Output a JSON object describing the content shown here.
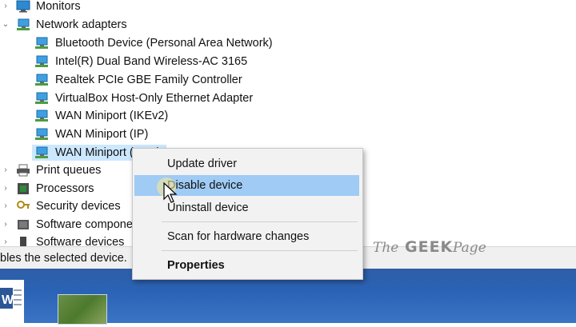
{
  "tree": {
    "items": [
      {
        "label": "Monitors",
        "expander": "›",
        "level": 0,
        "icon": "monitor-icon"
      },
      {
        "label": "Network adapters",
        "expander": "⌄",
        "level": 0,
        "icon": "network-adapter-icon"
      },
      {
        "label": "Bluetooth Device (Personal Area Network)",
        "level": 1,
        "icon": "network-adapter-icon"
      },
      {
        "label": "Intel(R) Dual Band Wireless-AC 3165",
        "level": 1,
        "icon": "network-adapter-icon"
      },
      {
        "label": "Realtek PCIe GBE Family Controller",
        "level": 1,
        "icon": "network-adapter-icon"
      },
      {
        "label": "VirtualBox Host-Only Ethernet Adapter",
        "level": 1,
        "icon": "network-adapter-icon"
      },
      {
        "label": "WAN Miniport (IKEv2)",
        "level": 1,
        "icon": "network-adapter-icon"
      },
      {
        "label": "WAN Miniport (IP)",
        "level": 1,
        "icon": "network-adapter-icon"
      },
      {
        "label": "WAN Miniport (IPv6)",
        "level": 1,
        "icon": "network-adapter-icon",
        "selected": true
      },
      {
        "label": "Print queues",
        "expander": "›",
        "level": 0,
        "icon": "printer-icon"
      },
      {
        "label": "Processors",
        "expander": "›",
        "level": 0,
        "icon": "processor-icon"
      },
      {
        "label": "Security devices",
        "expander": "›",
        "level": 0,
        "icon": "security-device-icon"
      },
      {
        "label": "Software components",
        "expander": "›",
        "level": 0,
        "icon": "software-component-icon"
      },
      {
        "label": "Software devices",
        "expander": "›",
        "level": 0,
        "icon": "software-device-icon"
      }
    ]
  },
  "context_menu": {
    "update_driver": "Update driver",
    "disable_device": "Disable device",
    "uninstall_device": "Uninstall device",
    "scan_hardware": "Scan for hardware changes",
    "properties": "Properties"
  },
  "status_bar": {
    "text": "bles the selected device."
  },
  "watermark": {
    "the": "The",
    "geek": "GEEK",
    "page": "Page"
  },
  "colors": {
    "selection": "#cce8ff",
    "menu_hover": "#9fcbf5",
    "taskbar": "#2a63b5"
  }
}
